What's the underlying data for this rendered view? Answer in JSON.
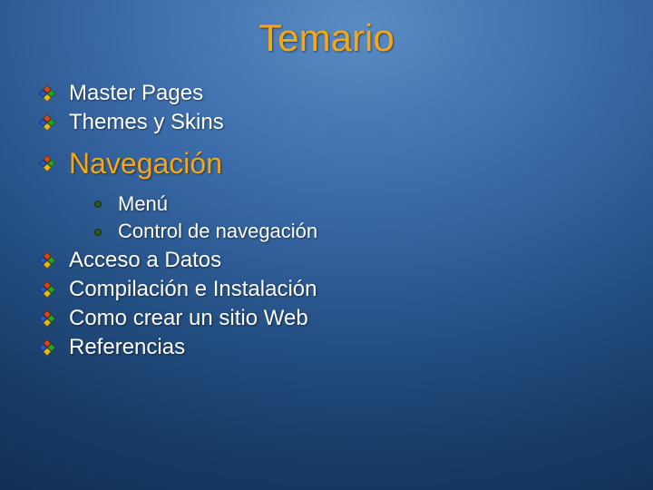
{
  "title": "Temario",
  "items": [
    {
      "type": "bullet",
      "text": "Master Pages"
    },
    {
      "type": "bullet",
      "text": "Themes y Skins"
    },
    {
      "type": "heading",
      "text": "Navegación"
    },
    {
      "type": "sub",
      "text": "Menú"
    },
    {
      "type": "sub",
      "text": "Control de navegación"
    },
    {
      "type": "bullet",
      "text": "Acceso a Datos"
    },
    {
      "type": "bullet",
      "text": "Compilación e Instalación"
    },
    {
      "type": "bullet",
      "text": "Como crear un sitio Web"
    },
    {
      "type": "bullet",
      "text": "Referencias"
    }
  ]
}
